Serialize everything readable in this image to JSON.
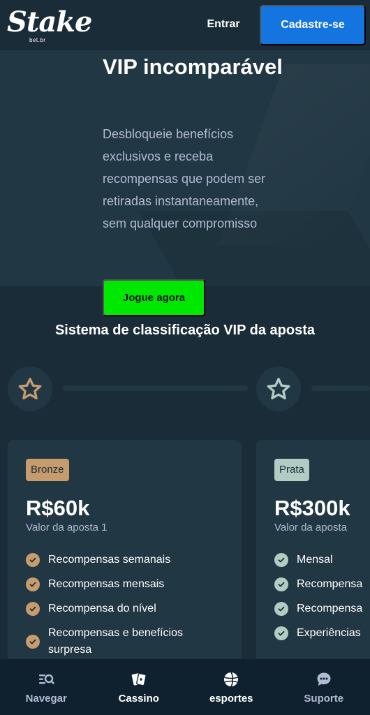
{
  "header": {
    "logo_text": "Stake",
    "logo_sub": "bet.br",
    "login_label": "Entrar",
    "signup_label": "Cadastre-se"
  },
  "hero": {
    "title": "VIP incomparável",
    "description": "Desbloqueie benefícios exclusivos e receba recompensas que podem ser retiradas instantaneamente, sem qualquer compromisso",
    "cta_label": "Jogue agora"
  },
  "section": {
    "title": "Sistema de classificação VIP da aposta"
  },
  "tiers": [
    {
      "badge": "Bronze",
      "amount": "R$60k",
      "subtitle": "Valor da aposta 1",
      "benefits": [
        "Recompensas semanais",
        "Recompensas mensais",
        "Recompensa do nível",
        "Recompensas e benefícios surpresa"
      ]
    },
    {
      "badge": "Prata",
      "amount": "R$300k",
      "subtitle": "Valor da aposta",
      "benefits": [
        "Mensal",
        "Recompensa",
        "Recompensa",
        "Experiências"
      ]
    }
  ],
  "nav": [
    {
      "label": "Navegar",
      "icon": "browse-icon"
    },
    {
      "label": "Cassino",
      "icon": "cards-icon"
    },
    {
      "label": "esportes",
      "icon": "ball-icon"
    },
    {
      "label": "Suporte",
      "icon": "chat-icon"
    }
  ],
  "colors": {
    "background": "#1a2c38",
    "panel": "#213743",
    "nav_background": "#0f212e",
    "primary_blue": "#1475e1",
    "accent_green": "#00e701",
    "bronze": "#c69c6d",
    "silver": "#b2ccc3",
    "muted_text": "#b1bad3"
  }
}
